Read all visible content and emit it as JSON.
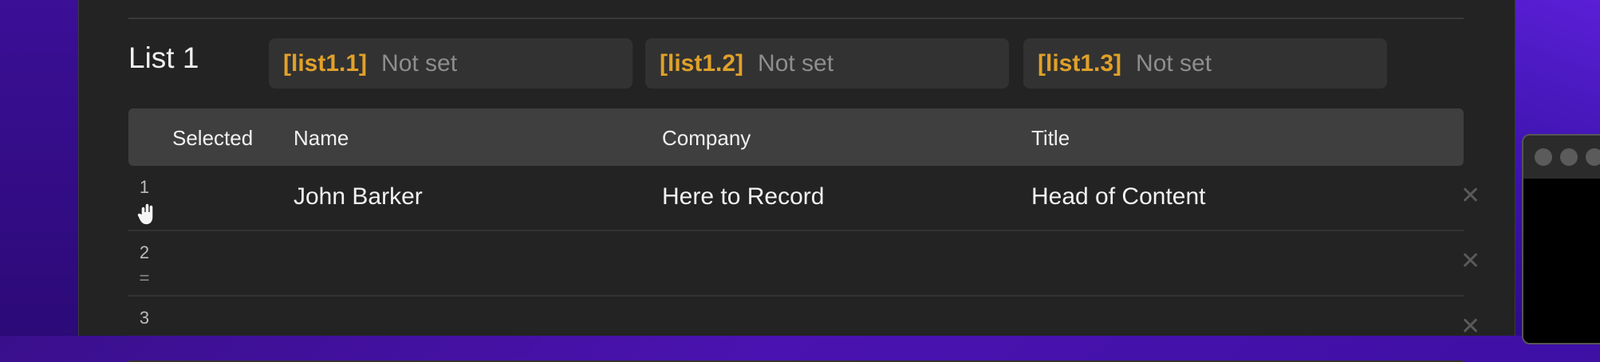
{
  "list": {
    "title": "List 1",
    "slots": [
      {
        "key": "[list1.1]",
        "value": "Not set"
      },
      {
        "key": "[list1.2]",
        "value": "Not set"
      },
      {
        "key": "[list1.3]",
        "value": "Not set"
      }
    ]
  },
  "table": {
    "headers": {
      "selected": "Selected",
      "name": "Name",
      "company": "Company",
      "title": "Title"
    },
    "rows": [
      {
        "num": "1",
        "handle": "=",
        "name": "John Barker",
        "company": "Here to Record",
        "title": "Head of Content",
        "delete": "✕"
      },
      {
        "num": "2",
        "handle": "=",
        "name": "",
        "company": "",
        "title": "",
        "delete": "✕"
      },
      {
        "num": "3",
        "handle": "",
        "name": "",
        "company": "",
        "title": "",
        "delete": "✕"
      }
    ]
  },
  "colors": {
    "accent": "#e0a12a",
    "panel": "#232323",
    "desktop": "#3a0f8c"
  }
}
